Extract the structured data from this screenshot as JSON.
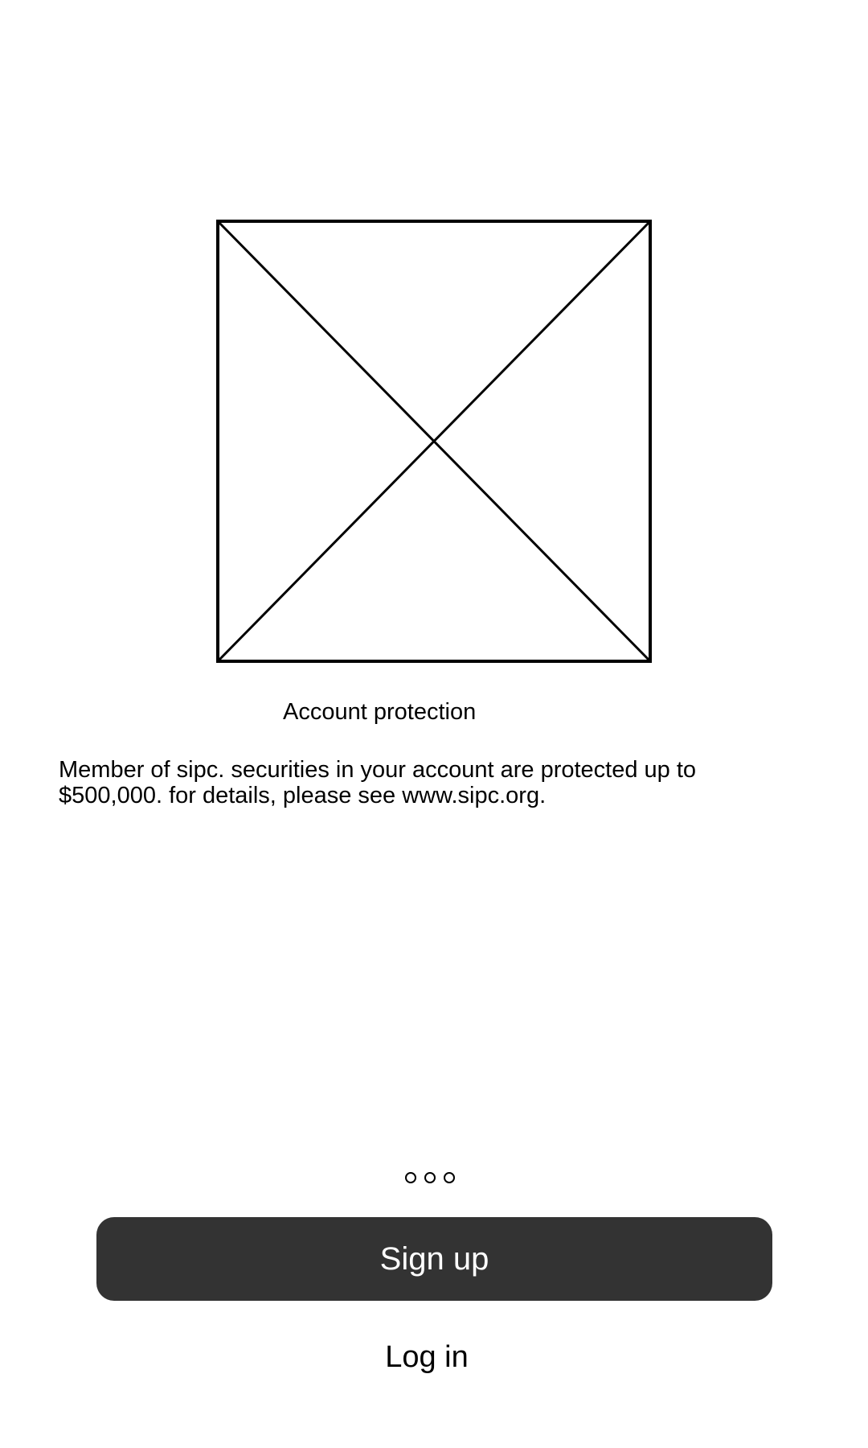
{
  "onboarding": {
    "image": {
      "icon": "image-placeholder-icon"
    },
    "title": "Account protection",
    "description": "Member of sipc. securities in your account are protected up to $500,000. for details, please see www.sipc.org.",
    "pager": {
      "pages": 3
    }
  },
  "actions": {
    "signup_label": "Sign up",
    "login_label": "Log in"
  },
  "colors": {
    "background": "#ffffff",
    "primary_button": "#333333",
    "text": "#000000"
  }
}
